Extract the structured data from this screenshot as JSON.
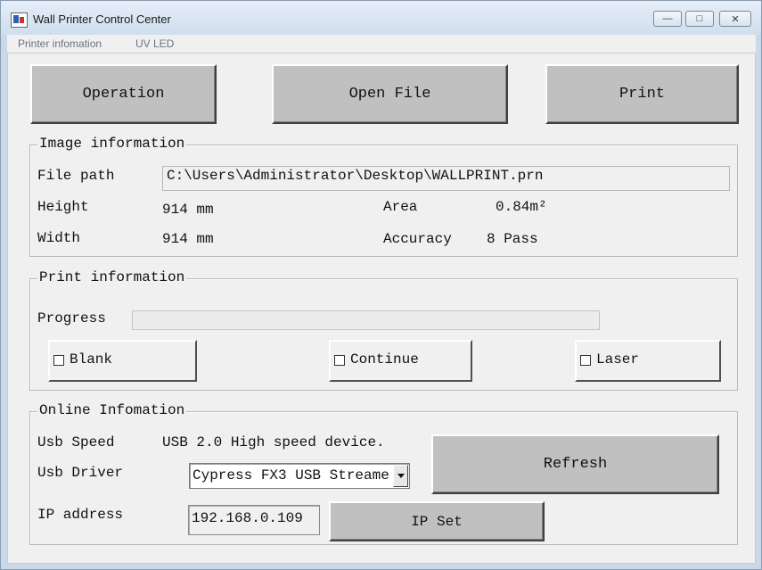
{
  "window": {
    "title": "Wall Printer Control Center",
    "controls": {
      "minimize": "—",
      "maximize": "□",
      "close": "✕"
    }
  },
  "menu": {
    "items": [
      "Printer infomation",
      "UV LED"
    ]
  },
  "toolbar": {
    "operation": "Operation",
    "open_file": "Open File",
    "print": "Print"
  },
  "image_info": {
    "title": "Image information",
    "file_path_label": "File path",
    "file_path": "C:\\Users\\Administrator\\Desktop\\WALLPRINT.prn",
    "height_label": "Height",
    "height": "914 mm",
    "width_label": "Width",
    "width": "914 mm",
    "area_label": "Area",
    "area": "0.84m²",
    "accuracy_label": "Accuracy",
    "accuracy": "8 Pass"
  },
  "print_info": {
    "title": "Print information",
    "progress_label": "Progress",
    "progress": 0,
    "blank": "Blank",
    "continue": "Continue",
    "laser": "Laser"
  },
  "online_info": {
    "title": "Online Infomation",
    "usb_speed_label": "Usb Speed",
    "usb_speed": "USB 2.0 High speed device.",
    "usb_driver_label": "Usb Driver",
    "usb_driver": "Cypress FX3 USB Streame",
    "refresh": "Refresh",
    "ip_label": "IP address",
    "ip": "192.168.0.109",
    "ip_set": "IP Set"
  },
  "icons": {
    "app": "printer-app-icon",
    "dropdown": "chevron-down-icon"
  }
}
